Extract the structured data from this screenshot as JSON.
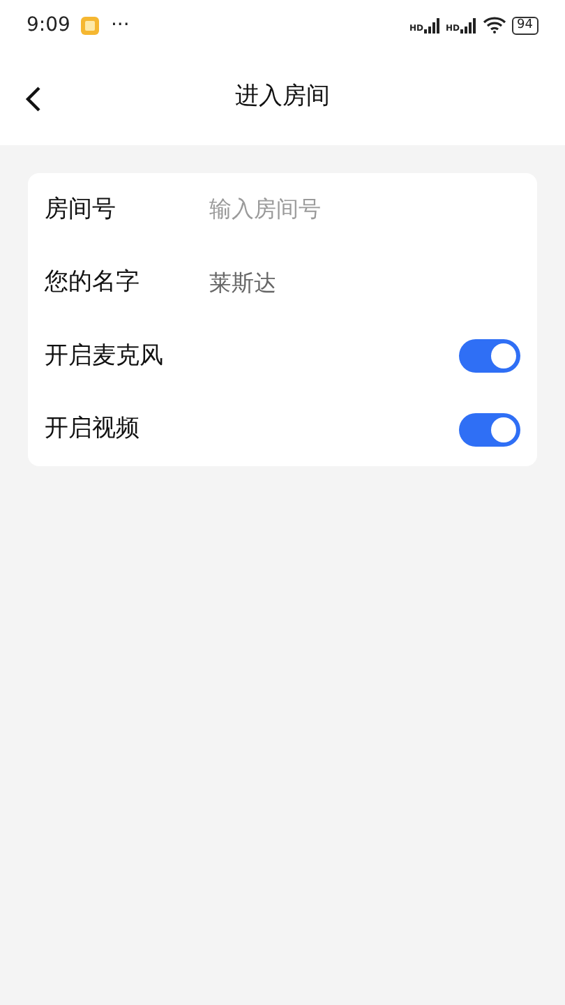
{
  "status_bar": {
    "time": "9:09",
    "more": "···",
    "signals": [
      {
        "label": "HD"
      },
      {
        "label": "HD"
      }
    ],
    "battery": "94"
  },
  "header": {
    "title": "进入房间"
  },
  "form": {
    "rows": [
      {
        "kind": "input",
        "label": "房间号",
        "placeholder": "输入房间号"
      },
      {
        "kind": "input",
        "label": "您的名字",
        "value": "莱斯达"
      },
      {
        "kind": "switch",
        "label": "开启麦克风",
        "on": true
      },
      {
        "kind": "switch",
        "label": "开启视频",
        "on": true
      }
    ]
  }
}
